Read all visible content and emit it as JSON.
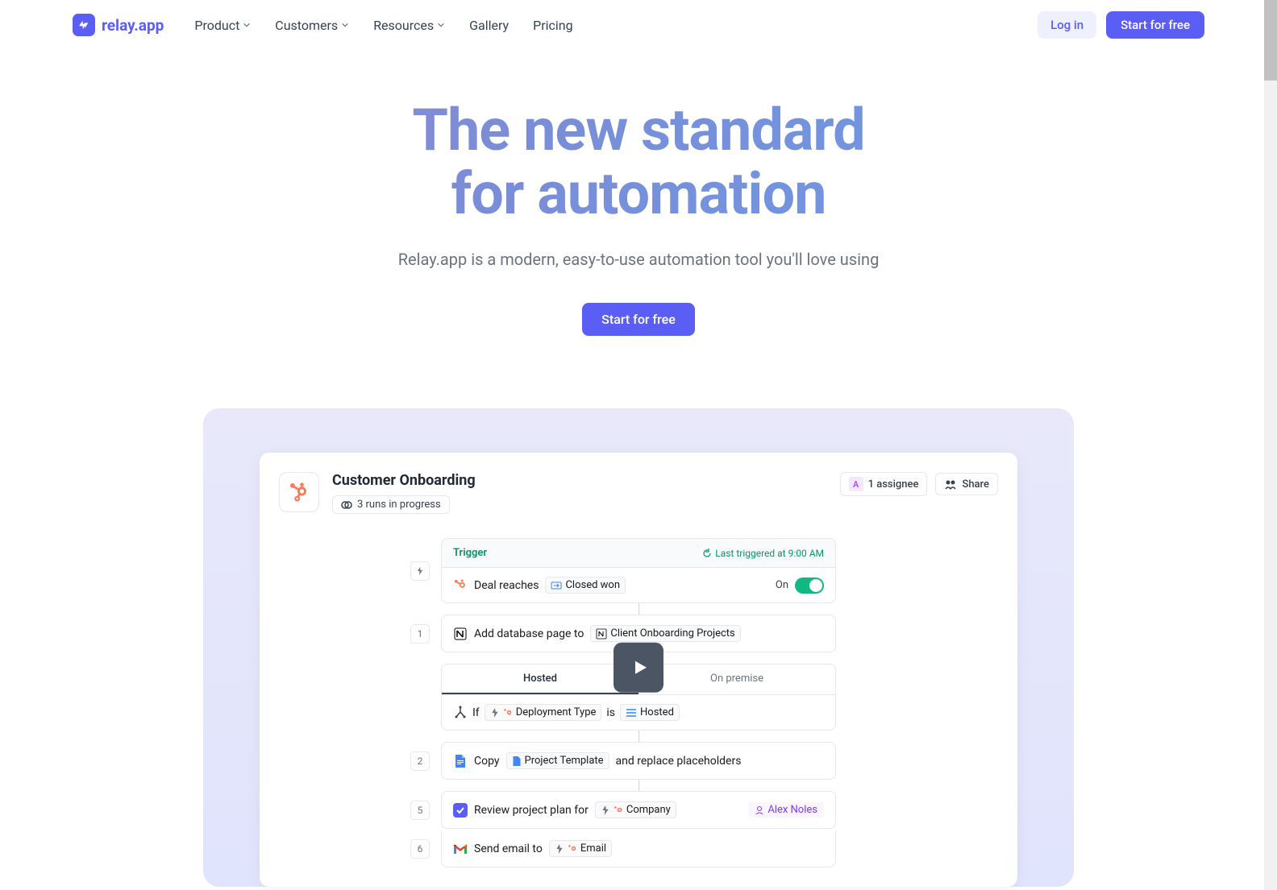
{
  "nav": {
    "logo_text": "relay.app",
    "links": [
      {
        "label": "Product",
        "has_dropdown": true
      },
      {
        "label": "Customers",
        "has_dropdown": true
      },
      {
        "label": "Resources",
        "has_dropdown": true
      },
      {
        "label": "Gallery",
        "has_dropdown": false
      },
      {
        "label": "Pricing",
        "has_dropdown": false
      }
    ],
    "login_label": "Log in",
    "cta_label": "Start for free"
  },
  "hero": {
    "title_line1": "The new standard",
    "title_line2": "for automation",
    "subtitle": "Relay.app is a modern, easy-to-use automation tool you'll love using",
    "cta_label": "Start for free"
  },
  "app": {
    "title": "Customer Onboarding",
    "runs_text": "3 runs in progress",
    "assignee_count": "1 assignee",
    "share_label": "Share",
    "trigger": {
      "label": "Trigger",
      "last_run": "Last triggered at 9:00 AM",
      "action_text": "Deal reaches",
      "status_chip": "Closed won",
      "toggle_label": "On"
    },
    "steps": {
      "step1": {
        "num": "1",
        "text": "Add database page to",
        "chip": "Client Onboarding Projects"
      },
      "tabs": {
        "tab1": "Hosted",
        "tab2": "On premise"
      },
      "condition": {
        "if": "If",
        "field": "Deployment Type",
        "op": "is",
        "value": "Hosted"
      },
      "step2": {
        "num": "2",
        "text": "Copy",
        "chip": "Project Template",
        "suffix": "and replace placeholders"
      },
      "step5": {
        "num": "5",
        "text": "Review project plan for",
        "chip": "Company",
        "assignee": "Alex Noles"
      },
      "step6": {
        "num": "6",
        "text": "Send email to",
        "chip": "Email"
      }
    },
    "trigger_bolt_num": "⚡"
  }
}
